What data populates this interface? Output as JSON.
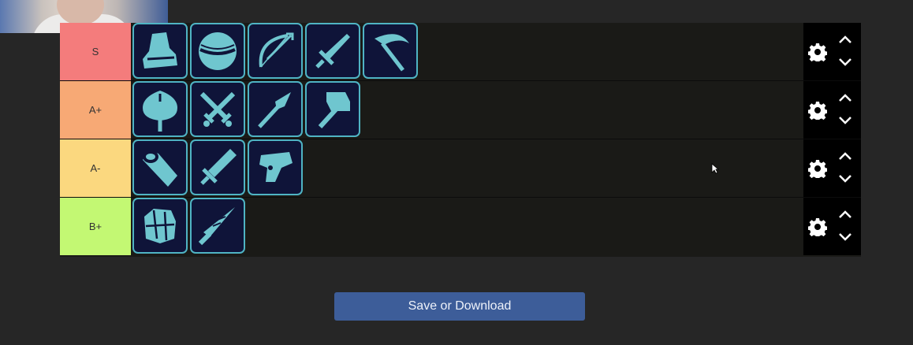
{
  "colors": {
    "background": "#262626",
    "tier_s": "#f47c7c",
    "tier_a_plus": "#f7a975",
    "tier_a_minus": "#fbd87f",
    "tier_b_plus": "#c3f873",
    "item_border": "#4fb4c4",
    "item_background": "#0f1439",
    "icon_fill": "#6fc6cf",
    "button": "#3d5d99"
  },
  "tiers": [
    {
      "label": "S",
      "color": "#f47c7c",
      "items": [
        "boot-icon",
        "orb-icon",
        "bow-icon",
        "sword-icon",
        "scythe-icon"
      ]
    },
    {
      "label": "A+",
      "color": "#f7a975",
      "items": [
        "axe-icon",
        "crossed-daggers-icon",
        "spear-icon",
        "hammer-icon"
      ]
    },
    {
      "label": "A-",
      "color": "#fbd87f",
      "items": [
        "cannon-icon",
        "greatsword-icon",
        "blaster-icon"
      ]
    },
    {
      "label": "B+",
      "color": "#c3f873",
      "items": [
        "gauntlets-icon",
        "lance-icon"
      ]
    }
  ],
  "controls": {
    "settings_icon": "gear-icon",
    "up_icon": "chevron-up-icon",
    "down_icon": "chevron-down-icon"
  },
  "save_button": {
    "label": "Save or Download"
  }
}
